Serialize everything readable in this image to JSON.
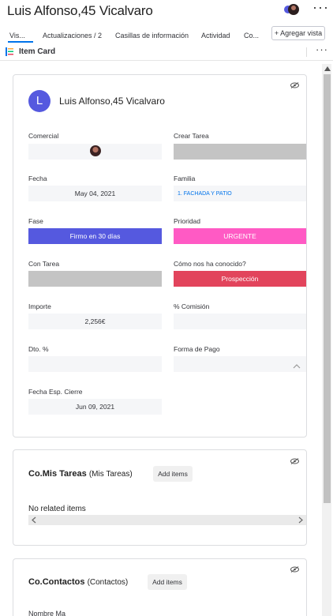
{
  "header": {
    "title": "Luis Alfonso,45 Vicalvaro",
    "more_label": "···"
  },
  "tabs": [
    {
      "label": "Vis..."
    },
    {
      "label": "Actualizaciones / 2"
    },
    {
      "label": "Casillas de información"
    },
    {
      "label": "Actividad"
    },
    {
      "label": "Co..."
    }
  ],
  "add_view_label": "+ Agregar vista",
  "section_bar": {
    "label": "Item Card",
    "more_label": "···"
  },
  "item_card": {
    "avatar_letter": "L",
    "title": "Luis Alfonso,45 Vicalvaro",
    "fields": {
      "comercial": {
        "label": "Comercial"
      },
      "crear_tarea": {
        "label": "Crear Tarea"
      },
      "fecha": {
        "label": "Fecha",
        "value": "May 04, 2021"
      },
      "familia": {
        "label": "Familia",
        "value": "1. FACHADA Y PATIO"
      },
      "fase": {
        "label": "Fase",
        "value": "Firmo en 30 días",
        "color": "#5559df"
      },
      "prioridad": {
        "label": "Prioridad",
        "value": "URGENTE",
        "color": "#ff5ac4"
      },
      "con_tarea": {
        "label": "Con Tarea"
      },
      "como_nos_conocido": {
        "label": "Cómo nos ha conocido?",
        "value": "Prospección",
        "color": "#e2445c"
      },
      "importe": {
        "label": "Importe",
        "value": "2,256€"
      },
      "comision": {
        "label": "% Comisión"
      },
      "dto": {
        "label": "Dto. %"
      },
      "forma_pago": {
        "label": "Forma de Pago"
      },
      "fecha_esp_cierre": {
        "label": "Fecha Esp. Cierre",
        "value": "Jun 09, 2021"
      }
    }
  },
  "mis_tareas": {
    "title": "Co.Mis Tareas",
    "subtitle": "(Mis Tareas)",
    "add_label": "Add items",
    "empty_text": "No related items"
  },
  "contactos": {
    "title": "Co.Contactos",
    "subtitle": "(Contactos)",
    "add_label": "Add items",
    "cut_text": "Nombre  Ma"
  },
  "icons": {
    "eye": "eye-off-icon",
    "scroll_up": "chevron-up-icon",
    "scroll_left": "chevron-left-icon",
    "scroll_right": "chevron-right-icon"
  }
}
